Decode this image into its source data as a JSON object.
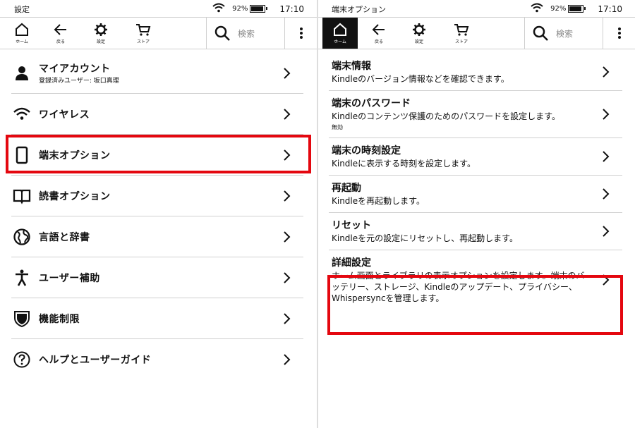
{
  "left": {
    "status": {
      "title": "設定",
      "battery": "92%",
      "battery_level": 0.92,
      "time": "17:10"
    },
    "toolbar": {
      "home": "ホーム",
      "back": "戻る",
      "settings": "設定",
      "store": "ストア",
      "search_placeholder": "検索"
    },
    "items": [
      {
        "label": "マイアカウント",
        "sub": "登録済みユーザー: 坂口真理",
        "icon": "person-icon"
      },
      {
        "label": "ワイヤレス",
        "icon": "wifi-icon"
      },
      {
        "label": "端末オプション",
        "icon": "device-icon"
      },
      {
        "label": "読書オプション",
        "icon": "book-icon"
      },
      {
        "label": "言語と辞書",
        "icon": "globe-icon"
      },
      {
        "label": "ユーザー補助",
        "icon": "accessibility-icon"
      },
      {
        "label": "機能制限",
        "icon": "shield-icon"
      },
      {
        "label": "ヘルプとユーザーガイド",
        "icon": "help-icon"
      }
    ]
  },
  "right": {
    "status": {
      "title": "端末オプション",
      "battery": "92%",
      "battery_level": 0.92,
      "time": "17:10"
    },
    "toolbar": {
      "home": "ホーム",
      "back": "戻る",
      "settings": "設定",
      "store": "ストア",
      "search_placeholder": "検索"
    },
    "items": [
      {
        "title": "端末情報",
        "desc": "Kindleのバージョン情報などを確認できます。"
      },
      {
        "title": "端末のパスワード",
        "desc": "Kindleのコンテンツ保護のためのパスワードを設定します。",
        "sub": "無効"
      },
      {
        "title": "端末の時刻設定",
        "desc": "Kindleに表示する時刻を設定します。"
      },
      {
        "title": "再起動",
        "desc": "Kindleを再起動します。"
      },
      {
        "title": "リセット",
        "desc": "Kindleを元の設定にリセットし、再起動します。"
      },
      {
        "title": "詳細設定",
        "desc": "ホーム画面とライブラリの表示オプションを設定します。端末のバッテリー、ストレージ、Kindleのアップデート、プライバシー、Whispersyncを管理します。"
      }
    ]
  },
  "colors": {
    "highlight": "#e4070f",
    "accent": "#111111"
  }
}
